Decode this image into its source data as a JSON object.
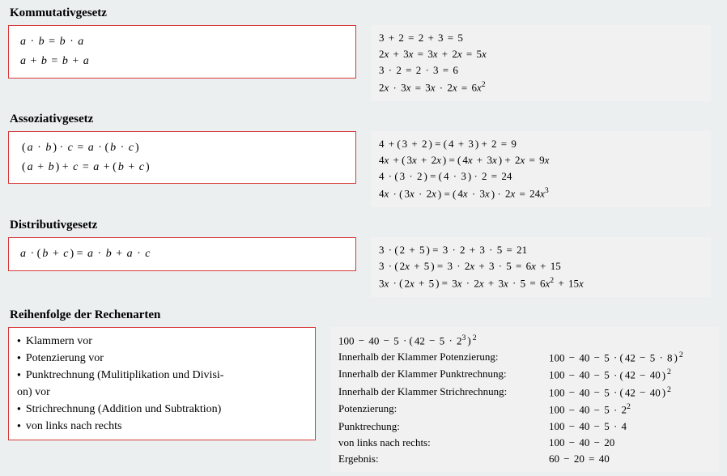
{
  "sections": {
    "kommutativ": {
      "title": "Kommutativgesetz",
      "law1": "a · b = b · a",
      "law2": "a + b = b + a",
      "ex1": "3 + 2 = 2 + 3 = 5",
      "ex2": "2x + 3x = 3x + 2x = 5x",
      "ex3": "3 · 2 = 2 · 3 = 6",
      "ex4_a": "2x · 3x = 3x · 2x = 6x",
      "ex4_sup": "2"
    },
    "assoziativ": {
      "title": "Assoziativgesetz",
      "law1": "(a · b) · c = a · (b · c)",
      "law2": "(a + b) + c = a + (b + c)",
      "ex1": "4 + (3 + 2) = (4 + 3) + 2 = 9",
      "ex2": "4x + (3x + 2x) = (4x + 3x) + 2x = 9x",
      "ex3": "4 · (3 · 2) = (4 · 3) · 2 = 24",
      "ex4_a": "4x · (3x · 2x) = (4x · 3x) · 2x = 24x",
      "ex4_sup": "3"
    },
    "distributiv": {
      "title": "Distributivgesetz",
      "law1": "a · (b + c) = a · b + a · c",
      "ex1": "3 · (2 + 5) = 3 · 2 + 3 · 5 = 21",
      "ex2": "3 · (2x + 5) = 3 · 2x + 3 · 5 = 6x + 15",
      "ex3_a": "3x · (2x + 5) = 3x · 2x + 3x · 5 = 6x",
      "ex3_sup": "2",
      "ex3_b": " + 15x"
    },
    "reihenfolge": {
      "title": "Reihenfolge der Rechenarten",
      "b1": "Klammern vor",
      "b2": "Potenzierung vor",
      "b3": "Punktrechnung (Mulitiplikation und Divisi-",
      "b3b": "on) vor",
      "b4": "Strichrechnung (Addition und Subtraktion)",
      "b5": "von links nach rechts",
      "expr0_a": "100 − 40 − 5 · (42 − 5 · 2",
      "expr0_sup1": "3",
      "expr0_b": ")",
      "expr0_sup2": "2",
      "s1_label": "Innerhalb der Klammer Potenzierung:",
      "s1_a": "100 − 40 − 5 · (42 − 5 · 8)",
      "s1_sup": "2",
      "s2_label": "Innerhalb der Klammer Punktrechnung:",
      "s2_a": "100 − 40 − 5 · (42 − 40)",
      "s2_sup": "2",
      "s3_label": "Innerhalb der Klammer Strichrechnung:",
      "s3_a": "100 − 40 − 5 · (42 − 40)",
      "s3_sup": "2",
      "s4_label": "Potenzierung:",
      "s4_a": "100 − 40 − 5 · 2",
      "s4_sup": "2",
      "s5_label": "Punktrechung:",
      "s5_a": "100 − 40 − 5 · 4",
      "s6_label": "von links nach rechts:",
      "s6_a": "100 − 40 − 20",
      "s7_label": "Ergebnis:",
      "s7_a": "60 − 20 = 40"
    }
  }
}
